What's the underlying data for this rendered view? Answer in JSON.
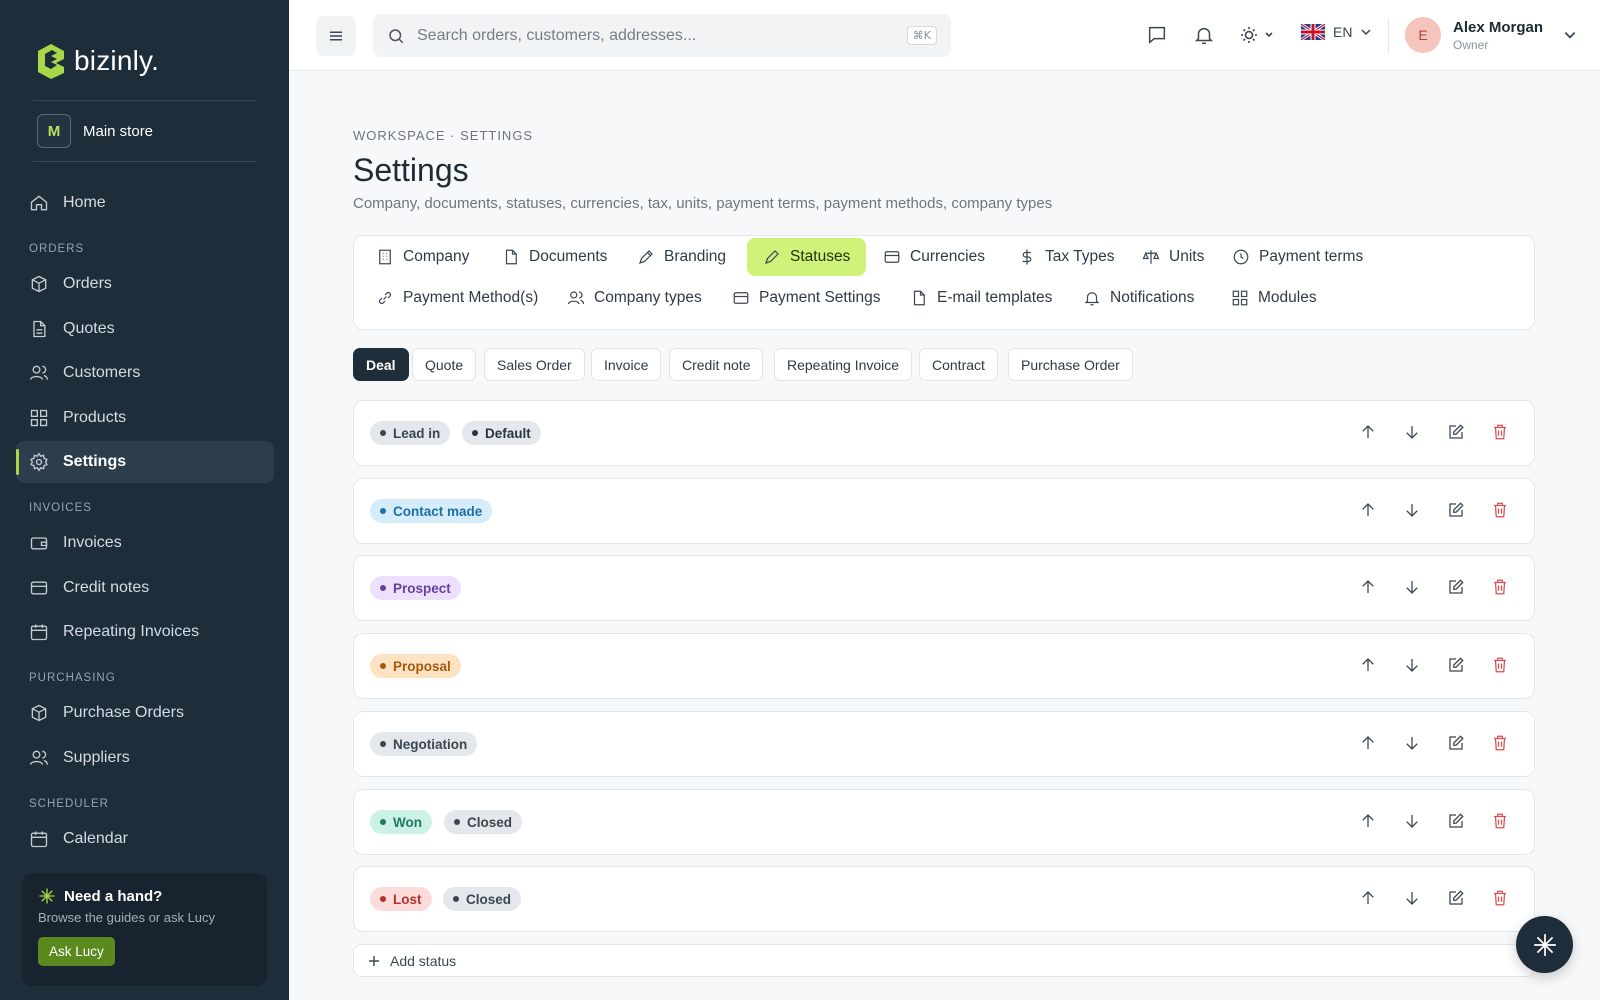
{
  "sidebar": {
    "brand": "bizinly.",
    "store": {
      "badge": "M",
      "name": "Main store"
    },
    "sections": {
      "orders": "ORDERS",
      "invoices": "INVOICES",
      "purchasing": "PURCHASING",
      "scheduler": "SCHEDULER"
    },
    "items": {
      "home": "Home",
      "orders": "Orders",
      "quotes": "Quotes",
      "customers": "Customers",
      "products": "Products",
      "settings": "Settings",
      "invoices": "Invoices",
      "credit_notes": "Credit notes",
      "repeating_invoices": "Repeating Invoices",
      "purchase_orders": "Purchase Orders",
      "suppliers": "Suppliers",
      "calendar": "Calendar"
    },
    "help": {
      "title": "Need a hand?",
      "subtitle": "Browse the guides or ask Lucy",
      "button": "Ask Lucy"
    }
  },
  "topbar": {
    "search_placeholder": "Search orders, customers, addresses...",
    "search_shortcut": "⌘K",
    "language": "EN",
    "user": {
      "initial": "E",
      "name": "Alex Morgan",
      "role": "Owner"
    }
  },
  "page": {
    "breadcrumb": "WORKSPACE · SETTINGS",
    "title": "Settings",
    "subtitle": "Company, documents, statuses, currencies, tax, units, payment terms, payment methods, company types"
  },
  "tabs": {
    "company": "Company",
    "documents": "Documents",
    "branding": "Branding",
    "statuses": "Statuses",
    "currencies": "Currencies",
    "tax_types": "Tax Types",
    "units": "Units",
    "payment_terms": "Payment terms",
    "payment_methods": "Payment Method(s)",
    "company_types": "Company types",
    "payment_settings": "Payment Settings",
    "email_templates": "E-mail templates",
    "notifications": "Notifications",
    "modules": "Modules"
  },
  "doc_types": {
    "deal": "Deal",
    "quote": "Quote",
    "sales_order": "Sales Order",
    "invoice": "Invoice",
    "credit_note": "Credit note",
    "repeating_invoice": "Repeating Invoice",
    "contract": "Contract",
    "purchase_order": "Purchase Order"
  },
  "statuses": [
    {
      "label": "Lead in",
      "tag": "Default",
      "color": "#3b4652"
    },
    {
      "label": "Contact made",
      "tag": "",
      "color": "#1f6fa8"
    },
    {
      "label": "Prospect",
      "tag": "",
      "color": "#6b3fa0"
    },
    {
      "label": "Proposal",
      "tag": "",
      "color": "#a8570f"
    },
    {
      "label": "Negotiation",
      "tag": "",
      "color": "#3b4652"
    },
    {
      "label": "Won",
      "tag": "Closed",
      "color": "#1d7a5f"
    },
    {
      "label": "Lost",
      "tag": "Closed",
      "color": "#b3322f"
    }
  ],
  "add_status": "Add status",
  "colors": {
    "accent": "#cff27a",
    "sidebar": "#1e2d3a",
    "danger": "#d94f4f"
  }
}
